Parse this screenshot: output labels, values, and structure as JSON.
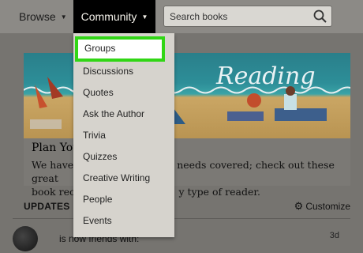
{
  "nav": {
    "browse_label": "Browse",
    "community_label": "Community",
    "search_placeholder": "Search books"
  },
  "icons": {
    "caret": "caret-down-icon",
    "search": "search-icon",
    "gear": "gear-icon"
  },
  "colors": {
    "highlight_border": "#31d615",
    "community_bg": "#000000"
  },
  "banner": {
    "title": "Reading"
  },
  "plan": {
    "title": "Plan You",
    "text_line1": "We have y",
    "text_line1_end": "needs covered; check out these great",
    "text_line2": "book reco",
    "text_line2_end": "y type of reader."
  },
  "dropdown": {
    "items": [
      {
        "label": "Groups"
      },
      {
        "label": "Discussions"
      },
      {
        "label": "Quotes"
      },
      {
        "label": "Ask the Author"
      },
      {
        "label": "Trivia"
      },
      {
        "label": "Quizzes"
      },
      {
        "label": "Creative Writing"
      },
      {
        "label": "People"
      },
      {
        "label": "Events"
      }
    ]
  },
  "updates": {
    "header": "UPDATES",
    "customize_label": "Customize",
    "feed_text": "is now friends with:",
    "feed_time": "3d"
  }
}
